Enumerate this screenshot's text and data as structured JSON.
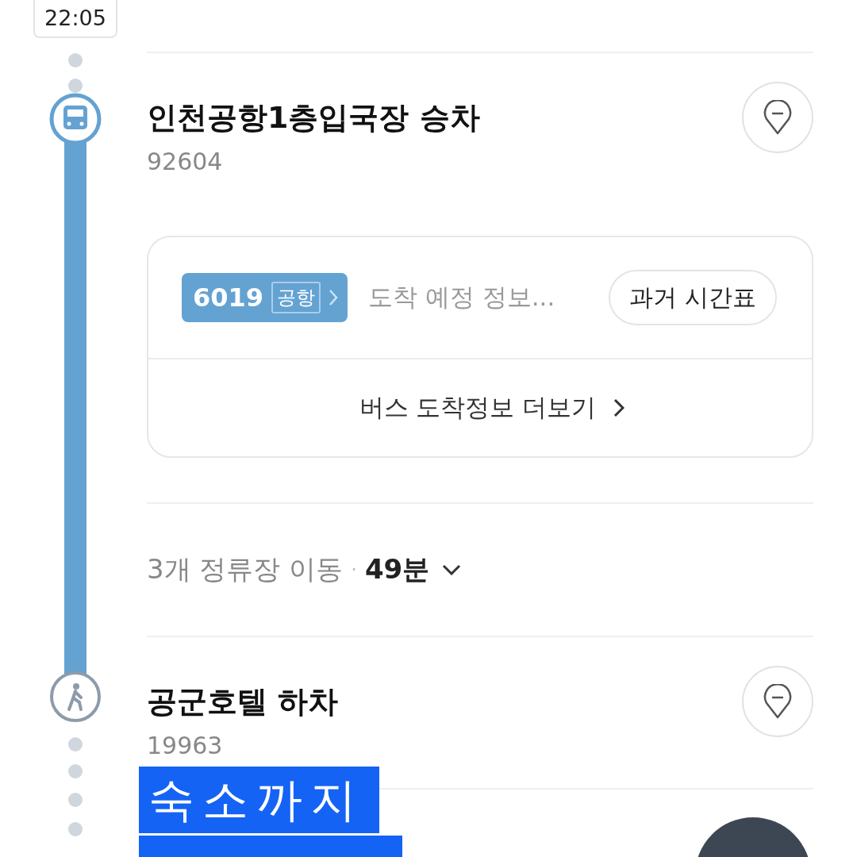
{
  "departure_time": "22:05",
  "stops": [
    {
      "kind": "board",
      "name": "인천공항1층입국장 승차",
      "code": "92604"
    },
    {
      "kind": "alight",
      "name": "공군호텔 하차",
      "code": "19963"
    }
  ],
  "bus_card": {
    "route_number": "6019",
    "route_type": "공항",
    "arrival": "도착 예정 정보...",
    "timetable_button": "과거 시간표",
    "more_link": "버스 도착정보 더보기"
  },
  "ride_summary": {
    "stops_text": "3개 정류장 이동",
    "separator": "·",
    "duration": "49분",
    "expanded": false
  },
  "annotation": {
    "lines": [
      "숙소까지"
    ]
  }
}
